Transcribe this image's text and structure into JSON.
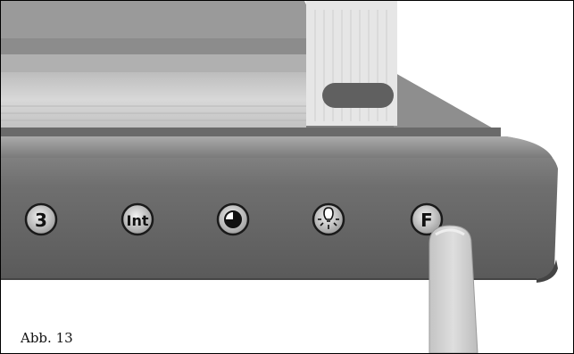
{
  "figure": {
    "caption": "Abb. 13"
  },
  "buttons": [
    {
      "label": "3",
      "icon": "text"
    },
    {
      "label": "Int",
      "icon": "text"
    },
    {
      "label": "",
      "icon": "pie-chart-icon"
    },
    {
      "label": "",
      "icon": "light-bulb-icon"
    },
    {
      "label": "F",
      "icon": "text"
    }
  ],
  "colors": {
    "panel_dark": "#6e6e6e",
    "panel_mid": "#9a9a9a",
    "panel_light": "#cfcfcf",
    "finger": "#d3d3d3"
  }
}
